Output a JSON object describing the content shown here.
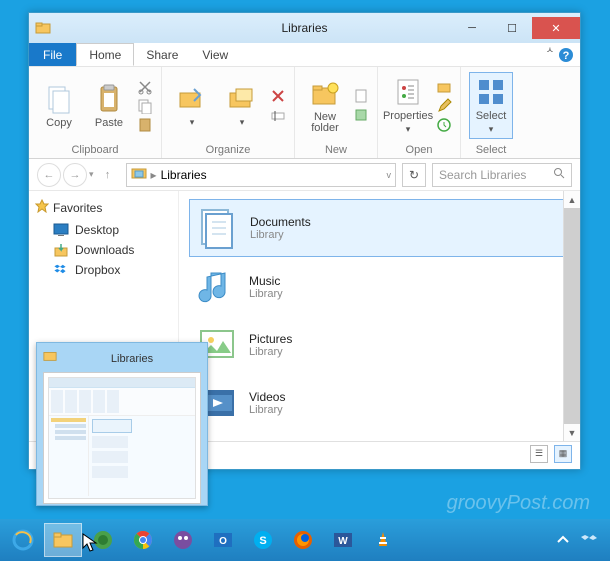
{
  "window": {
    "title": "Libraries",
    "tabs": {
      "file": "File",
      "home": "Home",
      "share": "Share",
      "view": "View"
    }
  },
  "ribbon": {
    "clipboard": {
      "label": "Clipboard",
      "copy": "Copy",
      "paste": "Paste"
    },
    "organize": {
      "label": "Organize"
    },
    "newgroup": {
      "label": "New",
      "newfolder": "New\nfolder"
    },
    "open": {
      "label": "Open",
      "properties": "Properties"
    },
    "select": {
      "label": "Select",
      "select": "Select"
    }
  },
  "nav": {
    "location": "Libraries",
    "searchPlaceholder": "Search Libraries"
  },
  "sidebar": {
    "favorites": "Favorites",
    "items": [
      "Desktop",
      "Downloads",
      "Dropbox"
    ]
  },
  "libraries": [
    {
      "name": "Documents",
      "sub": "Library"
    },
    {
      "name": "Music",
      "sub": "Library"
    },
    {
      "name": "Pictures",
      "sub": "Library"
    },
    {
      "name": "Videos",
      "sub": "Library"
    }
  ],
  "preview": {
    "title": "Libraries"
  },
  "watermark": "groovyPost.com"
}
